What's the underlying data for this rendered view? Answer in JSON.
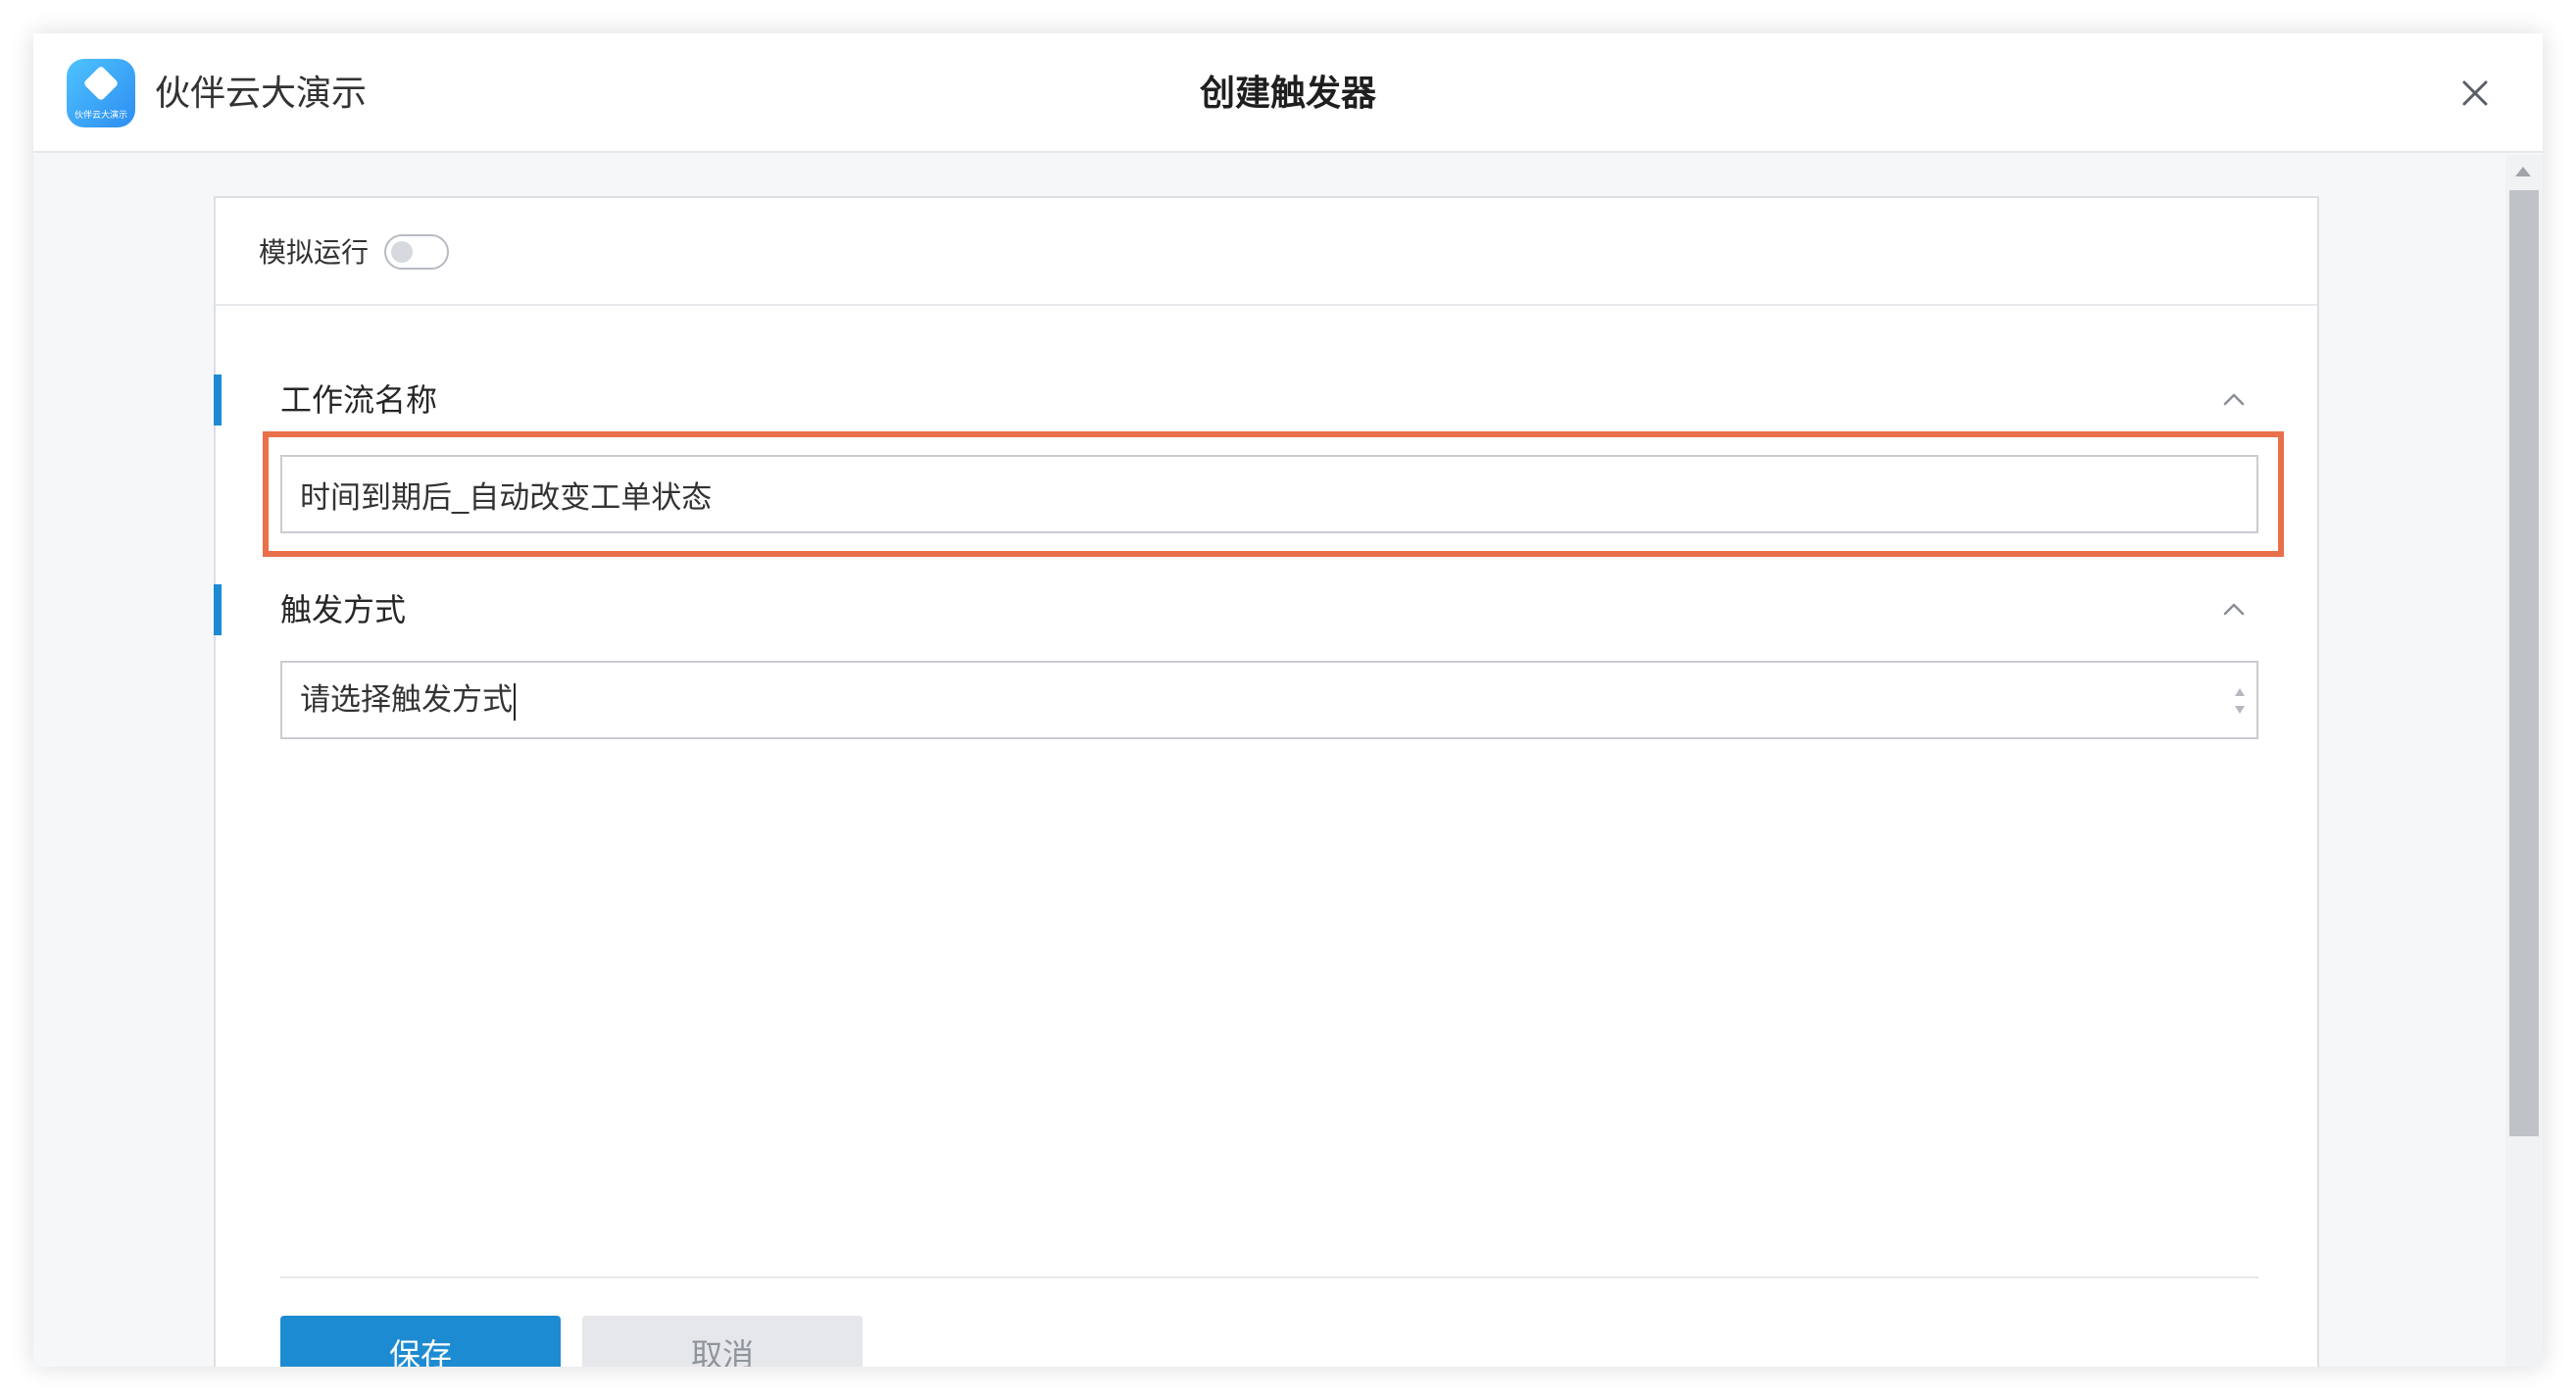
{
  "app": {
    "name": "伙伴云大演示",
    "logo_text": "伙伴云大演示",
    "brand_color": "#2d8df0"
  },
  "dialog": {
    "title": "创建触发器",
    "close_icon": "close-icon"
  },
  "simulation": {
    "label": "模拟运行",
    "enabled": false
  },
  "sections": {
    "workflow_name": {
      "title": "工作流名称",
      "value": "时间到期后_自动改变工单状态",
      "highlighted": true,
      "highlight_color": "#e9704a"
    },
    "trigger_method": {
      "title": "触发方式",
      "placeholder": "请选择触发方式"
    }
  },
  "buttons": {
    "save_label": "保存",
    "cancel_label": "取消",
    "save_color": "#1d8bd1"
  },
  "accent_color": "#1d8bd1"
}
